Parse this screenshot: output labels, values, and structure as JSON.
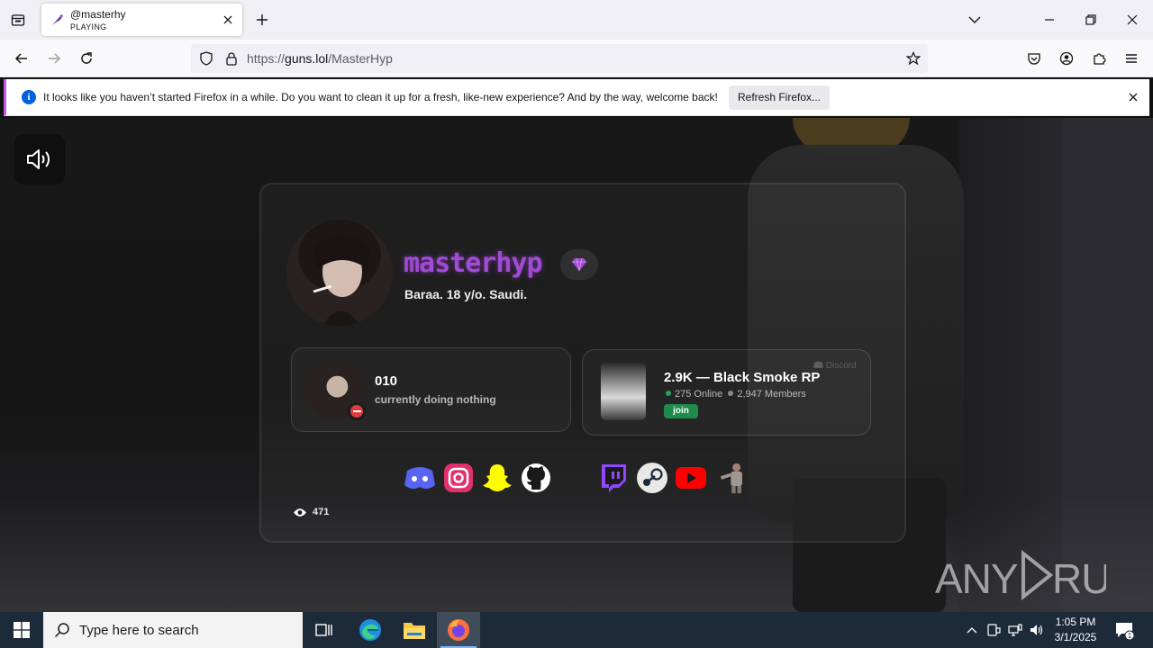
{
  "browser": {
    "tab": {
      "title": "@masterhy",
      "subtitle": "PLAYING"
    },
    "url": {
      "prefix": "https://",
      "domain": "guns.lol",
      "path": "/MasterHyp"
    }
  },
  "notification": {
    "message": "It looks like you haven’t started Firefox in a while. Do you want to clean it up for a fresh, like-new experience? And by the way, welcome back!",
    "button_label": "Refresh Firefox..."
  },
  "profile": {
    "username": "masterhyp",
    "bio": "Baraa. 18 y/o. Saudi.",
    "views": "471",
    "accent_color": "#a14ad6"
  },
  "presence": {
    "name": "010",
    "activity": "currently doing nothing",
    "status": "do-not-disturb"
  },
  "server": {
    "title": "2.9K — Black Smoke RP",
    "online": "275 Online",
    "members": "2,947 Members",
    "join_label": "join",
    "platform_label": "Discord"
  },
  "socials": [
    "discord",
    "instagram",
    "snapchat",
    "github",
    "twitch",
    "steam",
    "youtube",
    "custom"
  ],
  "watermark": "ANY RUN",
  "taskbar": {
    "search_placeholder": "Type here to search",
    "time": "1:05 PM",
    "date": "3/1/2025",
    "notification_count": "1"
  }
}
